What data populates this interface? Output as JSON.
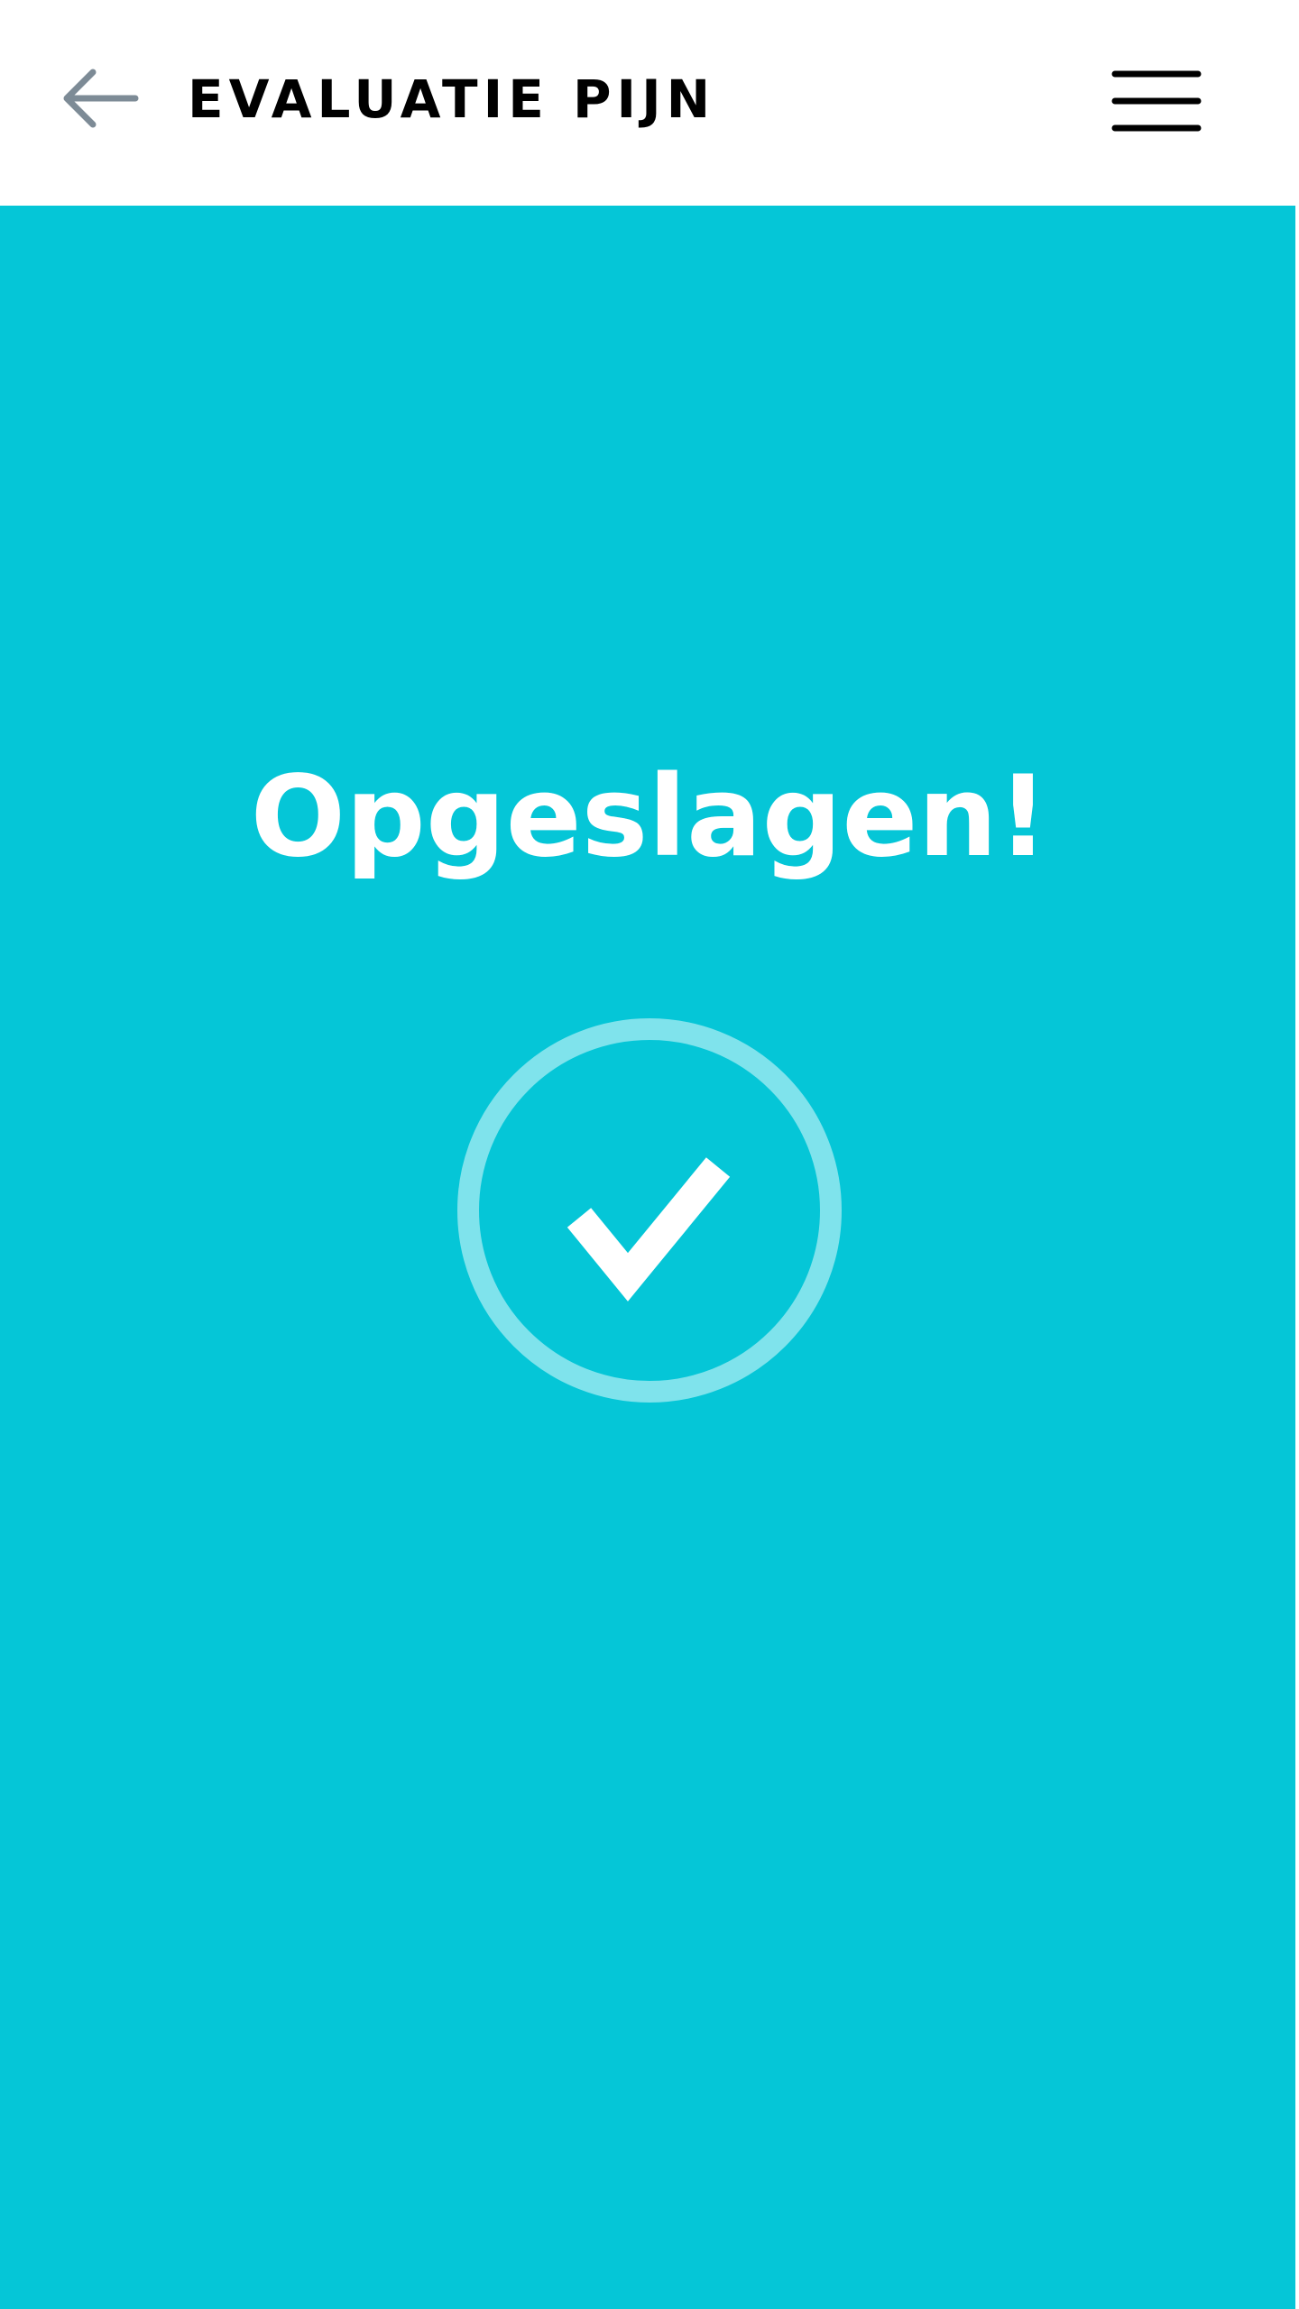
{
  "colors": {
    "header_background": "#ffffff",
    "main_background": "#05c6d7",
    "ring_color": "#7fe3ec",
    "title_text": "#000000",
    "back_icon": "#7d8b96",
    "menu_icon": "#000000",
    "saved_text": "#ffffff",
    "check_color": "#ffffff"
  },
  "header": {
    "back_icon": "arrow-left-icon",
    "title": "EVALUATIE PIJN",
    "menu_icon": "hamburger-menu-icon"
  },
  "main": {
    "message": "Opgeslagen!",
    "status_icon": "checkmark-circle-icon"
  }
}
